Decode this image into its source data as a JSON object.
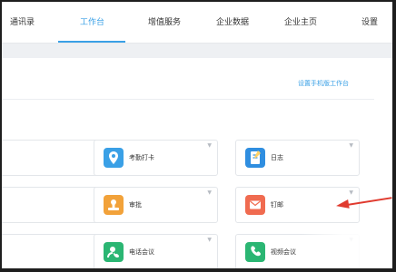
{
  "nav": {
    "items": [
      "通讯录",
      "工作台",
      "增值服务",
      "企业数据",
      "企业主页",
      "设置"
    ],
    "active_index": 1,
    "accent_color": "#3aa0e6"
  },
  "workbench": {
    "settings_link": "设置手机版工作台"
  },
  "apps": [
    {
      "label": "",
      "icon": "unknown-icon",
      "color": "#ffffff"
    },
    {
      "label": "考勤打卡",
      "icon": "location-pin-icon",
      "color": "#3aa0e6"
    },
    {
      "label": "日志",
      "icon": "notebook-icon",
      "color": "#2f8ee0"
    },
    {
      "label": "",
      "icon": "unknown-icon",
      "color": "#ffffff"
    },
    {
      "label": "审批",
      "icon": "stamp-icon",
      "color": "#f2a23a"
    },
    {
      "label": "钉邮",
      "icon": "mail-icon",
      "color": "#f06b50"
    },
    {
      "label": "",
      "icon": "unknown-icon",
      "color": "#ffffff"
    },
    {
      "label": "电话会议",
      "icon": "phone-call-icon",
      "color": "#2bb673"
    },
    {
      "label": "视频会议",
      "icon": "video-call-icon",
      "color": "#2bb673"
    }
  ],
  "annotation_arrow_color": "#e03a2e"
}
